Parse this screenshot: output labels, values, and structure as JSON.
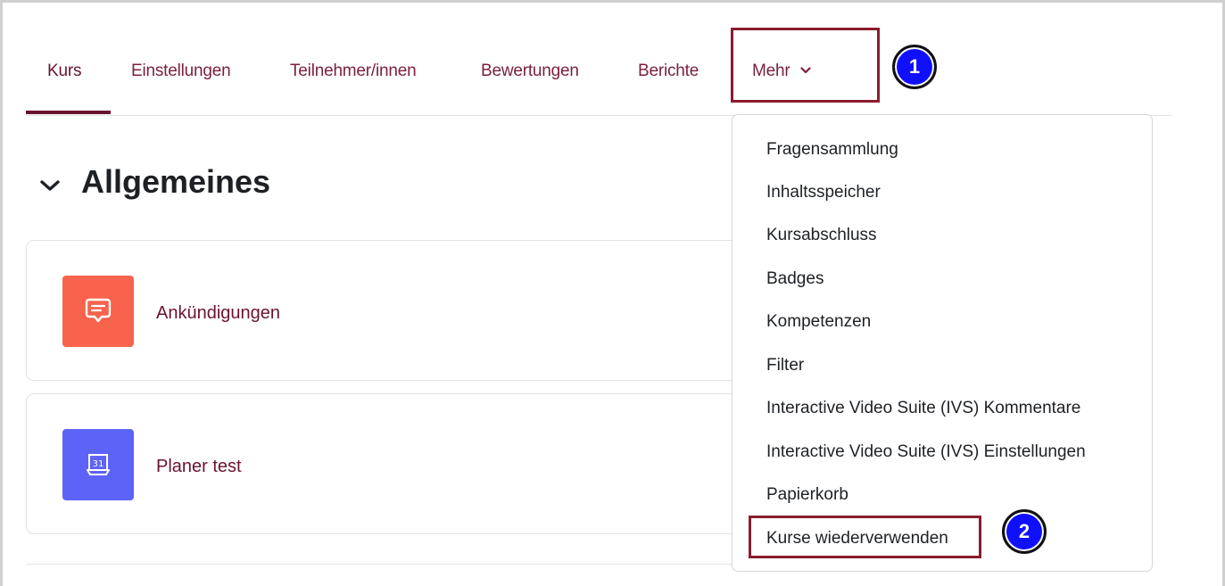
{
  "nav": {
    "items": [
      {
        "label": "Kurs"
      },
      {
        "label": "Einstellungen"
      },
      {
        "label": "Teilnehmer/innen"
      },
      {
        "label": "Bewertungen"
      },
      {
        "label": "Berichte"
      },
      {
        "label": "Mehr"
      }
    ]
  },
  "annotations": {
    "step1": "1",
    "step2": "2"
  },
  "section": {
    "title": "Allgemeines"
  },
  "activities": [
    {
      "label": "Ankündigungen",
      "icon": "forum-icon",
      "color": "#f7634d"
    },
    {
      "label": "Planer test",
      "icon": "calendar-icon",
      "color": "#5d63f6"
    }
  ],
  "more_menu": {
    "items": [
      {
        "label": "Fragensammlung"
      },
      {
        "label": "Inhaltsspeicher"
      },
      {
        "label": "Kursabschluss"
      },
      {
        "label": "Badges"
      },
      {
        "label": "Kompetenzen"
      },
      {
        "label": "Filter"
      },
      {
        "label": "Interactive Video Suite (IVS) Kommentare"
      },
      {
        "label": "Interactive Video Suite (IVS) Einstellungen"
      },
      {
        "label": "Papierkorb"
      },
      {
        "label": "Kurse wiederverwenden"
      }
    ]
  },
  "colors": {
    "brand": "#6a1232",
    "highlight_box": "#8a1c30",
    "badge": "#1010ff"
  }
}
